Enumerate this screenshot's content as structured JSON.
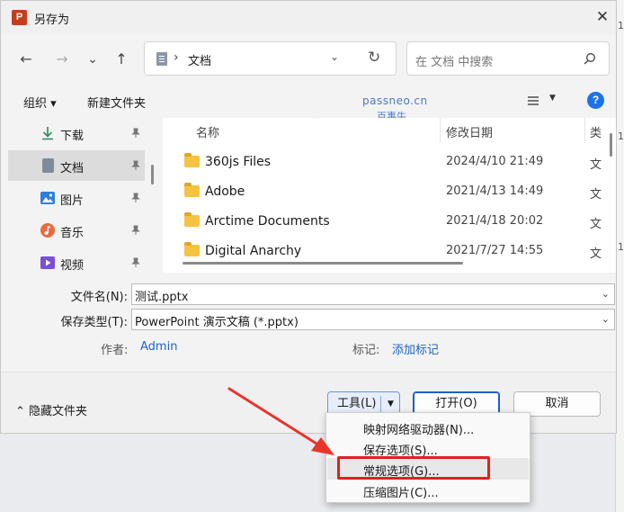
{
  "window": {
    "title": "另存为",
    "app_icon": "P",
    "close": "✕"
  },
  "nav": {
    "back": "←",
    "forward": "→",
    "recent": "⌄",
    "up": "↑"
  },
  "address": {
    "separator": "›",
    "location": "文档",
    "dropdown": "⌄",
    "refresh": "↻"
  },
  "search": {
    "placeholder": "在 文档 中搜索"
  },
  "toolbar": {
    "organize": "组织 ▾",
    "new_folder": "新建文件夹",
    "help": "?"
  },
  "watermark": {
    "line1": "passneo.cn",
    "line2": "百事牛"
  },
  "sidebar": {
    "items": [
      {
        "label": "下载",
        "icon": "download-icon",
        "color": "#2b8a5e"
      },
      {
        "label": "文档",
        "icon": "document-icon",
        "color": "#7f8b9c"
      },
      {
        "label": "图片",
        "icon": "picture-icon",
        "color": "#2f7fd8"
      },
      {
        "label": "音乐",
        "icon": "music-icon",
        "color": "#e86a3d"
      },
      {
        "label": "视频",
        "icon": "video-icon",
        "color": "#7b4fd6"
      }
    ]
  },
  "filelist": {
    "headers": {
      "name": "名称",
      "date": "修改日期",
      "type": "类"
    },
    "rows": [
      {
        "name": "360js Files",
        "date": "2024/4/10 21:49",
        "type": "文"
      },
      {
        "name": "Adobe",
        "date": "2021/4/13 14:49",
        "type": "文"
      },
      {
        "name": "Arctime Documents",
        "date": "2021/4/18 20:02",
        "type": "文"
      },
      {
        "name": "Digital Anarchy",
        "date": "2021/7/27 14:55",
        "type": "文"
      }
    ]
  },
  "form": {
    "filename_label": "文件名(N):",
    "filename_value": "测试.pptx",
    "filetype_label": "保存类型(T):",
    "filetype_value": "PowerPoint 演示文稿 (*.pptx)",
    "author_label": "作者:",
    "author_value": "Admin",
    "tags_label": "标记:",
    "tags_value": "添加标记",
    "dropdown": "⌄"
  },
  "footer": {
    "hide_folders": "⌃  隐藏文件夹",
    "tools": "工具(L)",
    "tools_caret": "▼",
    "open": "打开(O)",
    "cancel": "取消"
  },
  "menu": {
    "items": [
      "映射网络驱动器(N)...",
      "保存选项(S)...",
      "常规选项(G)...",
      "压缩图片(C)..."
    ],
    "highlighted_index": 2,
    "highlight_color": "#e02020"
  },
  "background": {
    "digits": [
      "1",
      "1",
      "1"
    ]
  }
}
